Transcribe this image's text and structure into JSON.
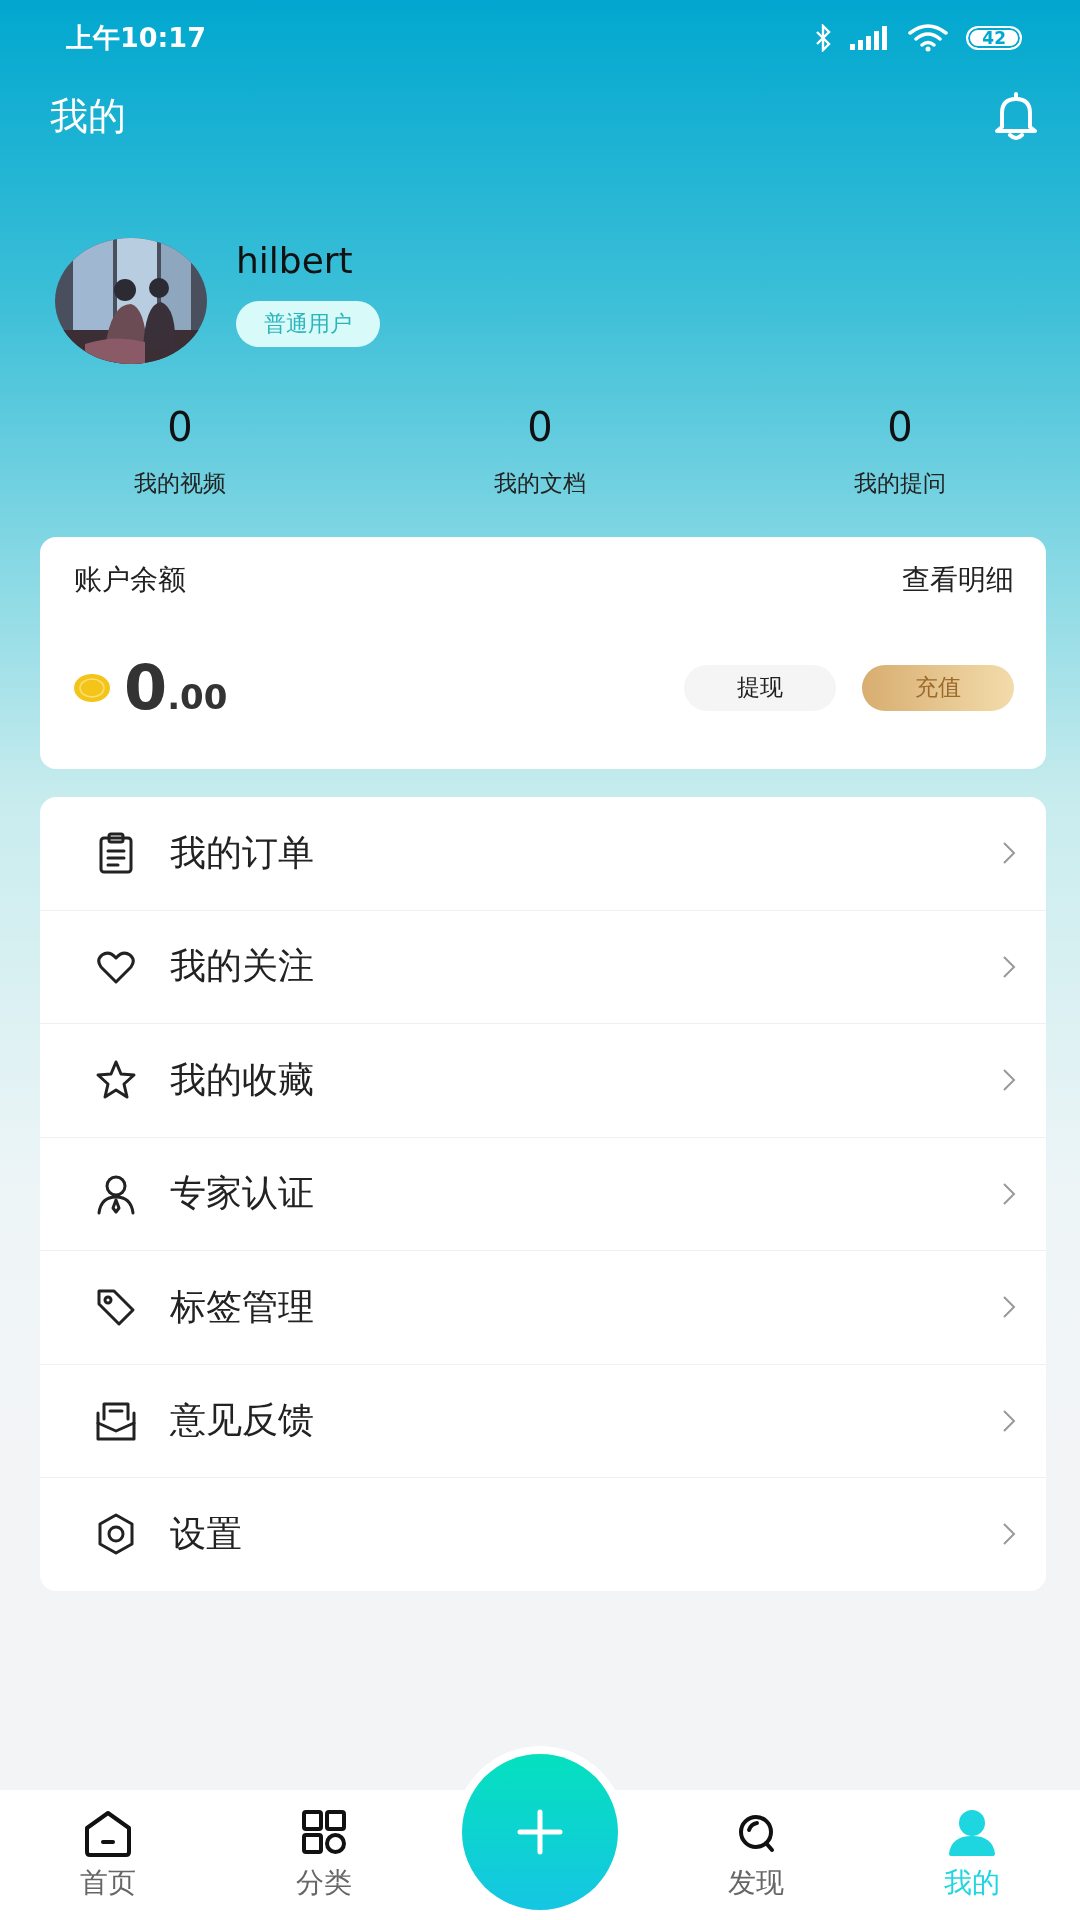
{
  "status_bar": {
    "time": "上午10:17",
    "battery": "42"
  },
  "header": {
    "title": "我的"
  },
  "profile": {
    "name": "hilbert",
    "badge": "普通用户"
  },
  "stats": [
    {
      "value": "0",
      "label": "我的视频"
    },
    {
      "value": "0",
      "label": "我的文档"
    },
    {
      "value": "0",
      "label": "我的提问"
    }
  ],
  "balance": {
    "title": "账户余额",
    "detail_link": "查看明细",
    "amount_integer": "0",
    "amount_decimal": ".00",
    "buttons": [
      {
        "label": "提现",
        "kind": "plain"
      },
      {
        "label": "充值",
        "kind": "gold"
      }
    ]
  },
  "menu": [
    {
      "label": "我的订单",
      "kind": "order"
    },
    {
      "label": "我的关注",
      "kind": "heart"
    },
    {
      "label": "我的收藏",
      "kind": "star"
    },
    {
      "label": "专家认证",
      "kind": "expert"
    },
    {
      "label": "标签管理",
      "kind": "tag"
    },
    {
      "label": "意见反馈",
      "kind": "feedback"
    },
    {
      "label": "设置",
      "kind": "settings"
    }
  ],
  "nav": [
    {
      "label": "首页",
      "kind": "home",
      "selected": false
    },
    {
      "label": "分类",
      "kind": "category",
      "selected": false
    },
    {
      "kind": "plus",
      "selected": false
    },
    {
      "label": "发现",
      "kind": "discover",
      "selected": false
    },
    {
      "label": "我的",
      "kind": "mine",
      "selected": true
    }
  ]
}
